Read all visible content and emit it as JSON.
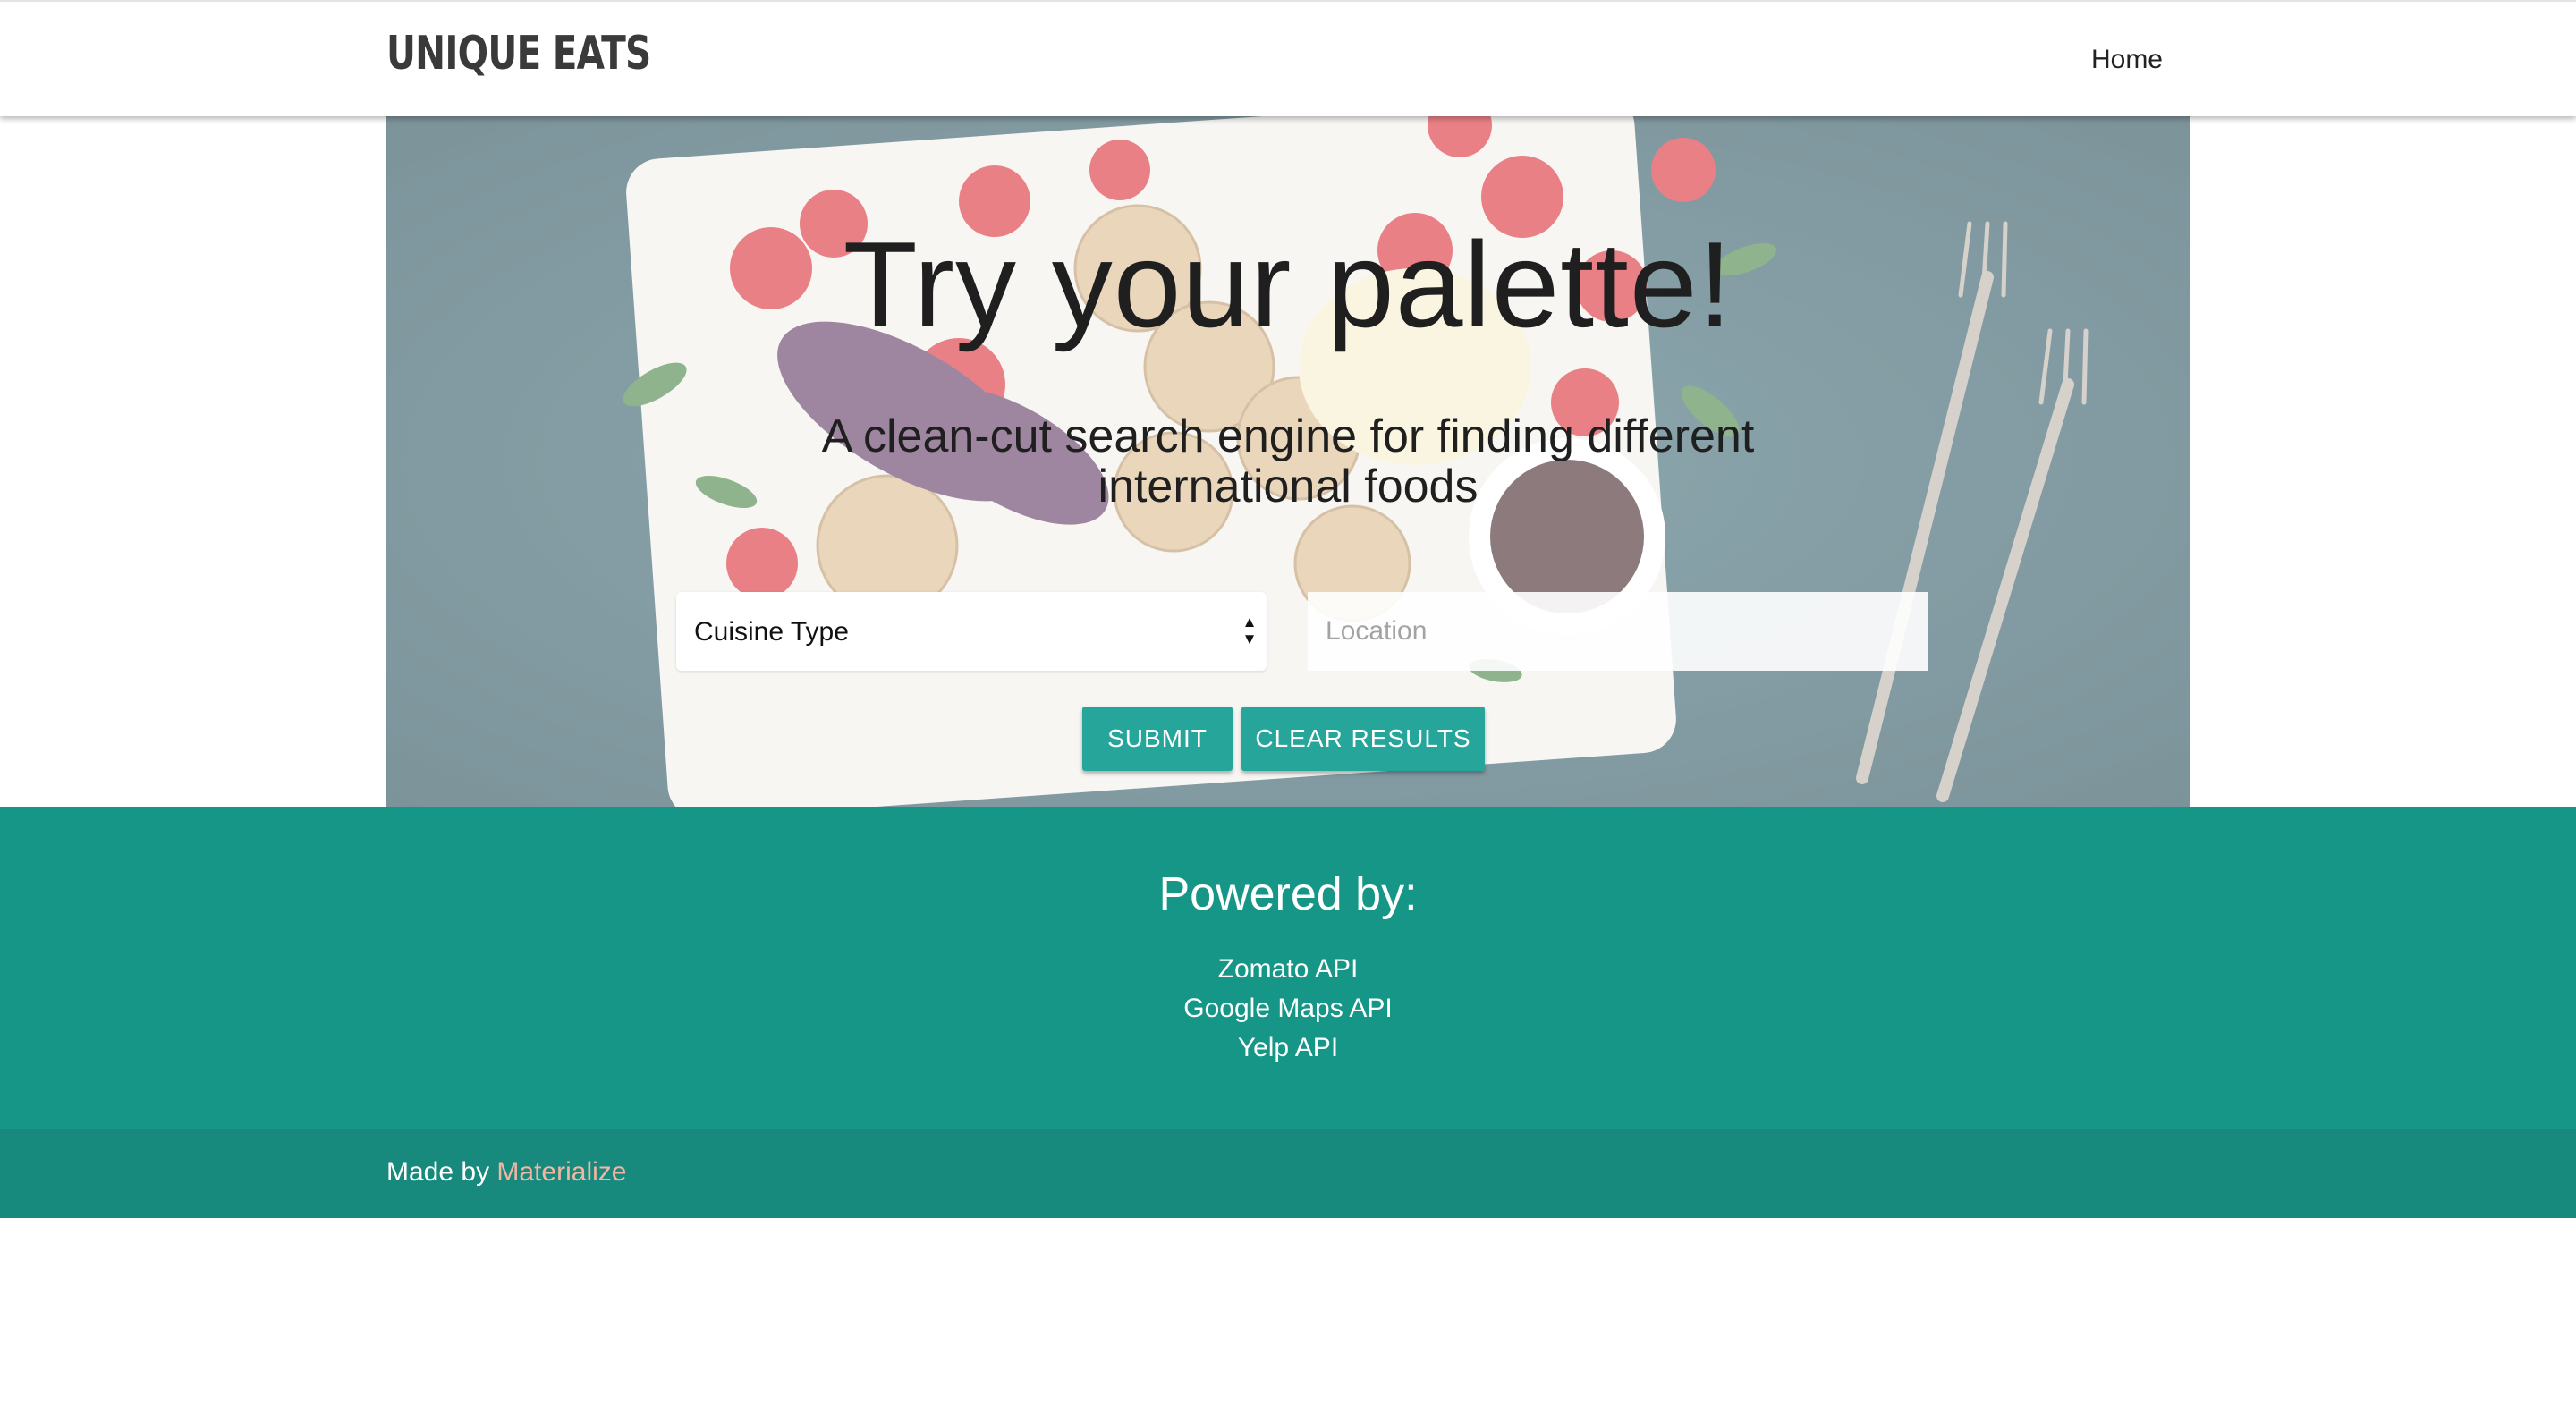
{
  "nav": {
    "brand": "UNIQUE EATS",
    "home_link": "Home"
  },
  "hero": {
    "title": "Try your palette!",
    "subtitle": "A clean-cut search engine for finding different international foods",
    "cuisine_select": {
      "selected": "Cuisine Type"
    },
    "location_input": {
      "placeholder": "Location",
      "value": ""
    },
    "submit_label": "SUBMIT",
    "clear_label": "CLEAR RESULTS"
  },
  "footer": {
    "heading": "Powered by:",
    "links": [
      "Zomato API",
      "Google Maps API",
      "Yelp API"
    ],
    "made_by_prefix": "Made by",
    "made_by_link": "Materialize"
  },
  "colors": {
    "accent": "#26a69a",
    "footer_bg": "#169686",
    "footer_copy_bg": "#178a7d",
    "link_accent": "#f2b6a5"
  },
  "icons": {
    "select_arrows": "up-down-arrows-icon"
  }
}
